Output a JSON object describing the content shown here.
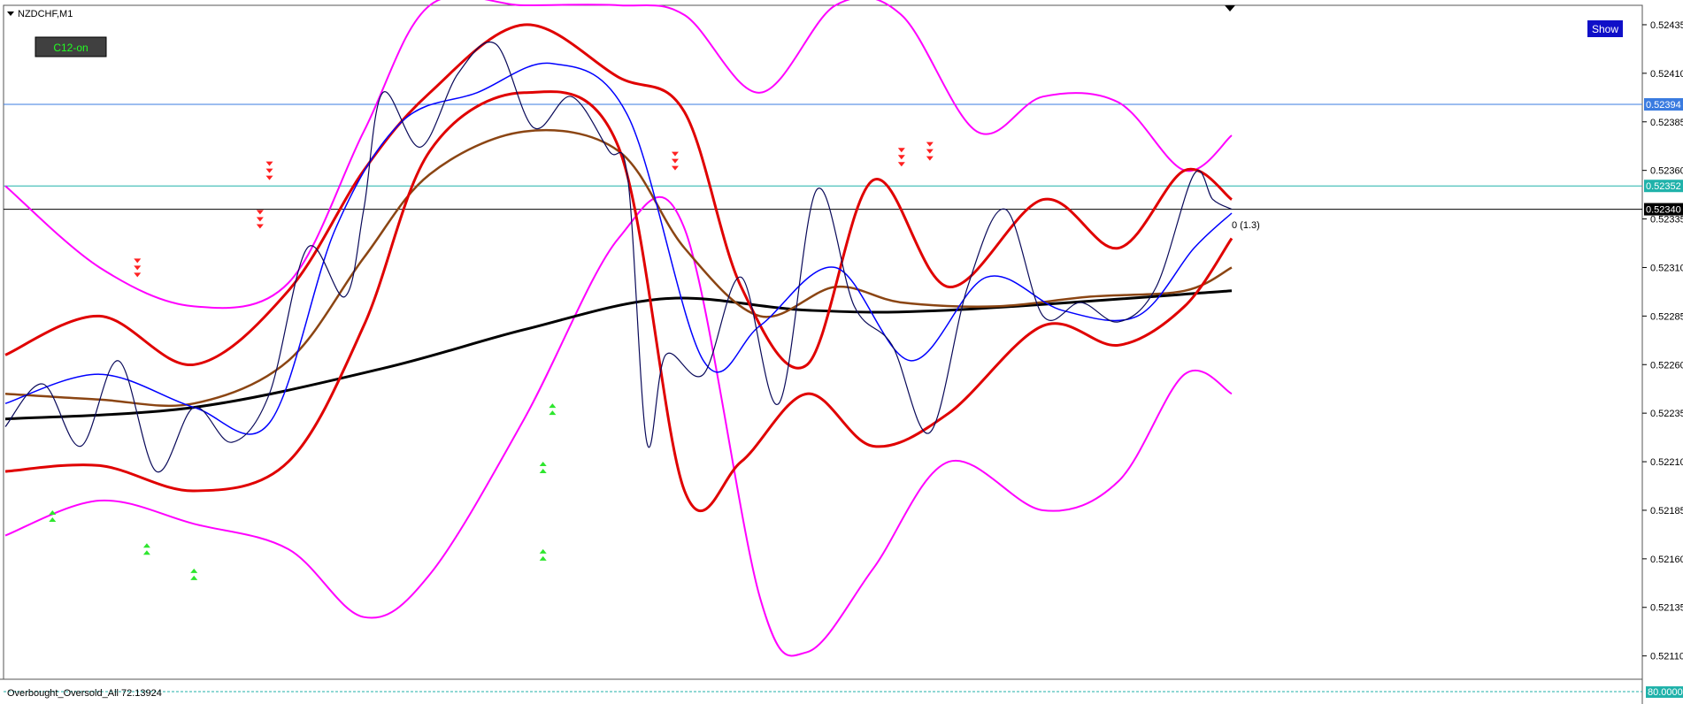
{
  "chart_data": {
    "type": "line",
    "title": "NZDCHF,M1",
    "symbol": "NZDCHF",
    "timeframe": "M1",
    "y_tick_labels": [
      "0.52435",
      "0.52410",
      "0.52385",
      "0.52360",
      "0.52335",
      "0.52310",
      "0.52285",
      "0.52260",
      "0.52235",
      "0.52210",
      "0.52185",
      "0.52160",
      "0.52135",
      "0.52110"
    ],
    "ylim": [
      0.52098,
      0.52445
    ],
    "grid": false,
    "price_level_tags": [
      {
        "value": 0.52394,
        "label": "0.52394",
        "color": "#3a7be0"
      },
      {
        "value": 0.52352,
        "label": "0.52352",
        "color": "#20b2aa"
      },
      {
        "value": 0.5234,
        "label": "0.52340",
        "color": "#000000"
      }
    ],
    "current_price_note": "0 (1.3)",
    "series": [
      {
        "role": "moving-average-long",
        "color": "#000000",
        "x": [
          0,
          20,
          40,
          55,
          70,
          85,
          100,
          130
        ],
        "values": [
          0.52232,
          0.52238,
          0.52258,
          0.52278,
          0.52294,
          0.52288,
          0.52288,
          0.52298
        ]
      },
      {
        "role": "envelope-outer-upper",
        "color": "#ff00ff",
        "x": [
          0,
          10,
          20,
          30,
          38,
          45,
          55,
          65,
          72,
          80,
          88,
          95,
          103,
          110,
          118,
          125,
          130
        ],
        "values": [
          0.52352,
          0.5231,
          0.5229,
          0.52302,
          0.5238,
          0.52445,
          0.52445,
          0.52445,
          0.5244,
          0.524,
          0.52445,
          0.5244,
          0.5238,
          0.52398,
          0.52395,
          0.5236,
          0.52378
        ]
      },
      {
        "role": "envelope-outer-lower",
        "color": "#ff00ff",
        "x": [
          0,
          10,
          20,
          30,
          38,
          45,
          55,
          65,
          72,
          80,
          85,
          92,
          100,
          110,
          118,
          125,
          130
        ],
        "values": [
          0.52172,
          0.5219,
          0.52178,
          0.52165,
          0.5213,
          0.52152,
          0.52232,
          0.52325,
          0.5233,
          0.5214,
          0.52112,
          0.52155,
          0.5221,
          0.52185,
          0.522,
          0.52255,
          0.52245
        ]
      },
      {
        "role": "band-upper",
        "color": "#e00000",
        "x": [
          0,
          10,
          20,
          30,
          38,
          45,
          55,
          65,
          72,
          78,
          85,
          92,
          100,
          110,
          118,
          125,
          130
        ],
        "values": [
          0.52265,
          0.52285,
          0.5226,
          0.52298,
          0.5236,
          0.524,
          0.52435,
          0.52408,
          0.5239,
          0.523,
          0.5226,
          0.52355,
          0.523,
          0.52345,
          0.5232,
          0.5236,
          0.52345
        ]
      },
      {
        "role": "band-lower",
        "color": "#e00000",
        "x": [
          0,
          10,
          20,
          30,
          38,
          45,
          55,
          65,
          72,
          78,
          85,
          92,
          100,
          110,
          118,
          125,
          130
        ],
        "values": [
          0.52205,
          0.52208,
          0.52195,
          0.5221,
          0.5228,
          0.5237,
          0.524,
          0.52372,
          0.52195,
          0.5221,
          0.52245,
          0.52218,
          0.52235,
          0.5228,
          0.5227,
          0.5229,
          0.52325
        ]
      },
      {
        "role": "moving-average-mid",
        "color": "#8b4513",
        "x": [
          0,
          10,
          20,
          30,
          38,
          45,
          55,
          65,
          72,
          80,
          88,
          95,
          105,
          115,
          125,
          130
        ],
        "values": [
          0.52245,
          0.52242,
          0.5224,
          0.52262,
          0.52315,
          0.52358,
          0.5238,
          0.5237,
          0.5232,
          0.52285,
          0.523,
          0.52292,
          0.5229,
          0.52295,
          0.52298,
          0.5231
        ]
      },
      {
        "role": "moving-average-fast",
        "color": "#0000ff",
        "x": [
          0,
          10,
          20,
          28,
          35,
          42,
          50,
          58,
          66,
          74,
          80,
          88,
          96,
          104,
          112,
          120,
          126,
          130
        ],
        "values": [
          0.5224,
          0.52255,
          0.52238,
          0.5223,
          0.5233,
          0.52385,
          0.524,
          0.52415,
          0.52388,
          0.52262,
          0.5228,
          0.5231,
          0.52262,
          0.52305,
          0.52288,
          0.52285,
          0.5232,
          0.52338
        ]
      },
      {
        "role": "price",
        "color": "#0a0a5a",
        "x": [
          0,
          4,
          8,
          12,
          16,
          20,
          24,
          28,
          32,
          36,
          38,
          40,
          44,
          48,
          52,
          56,
          60,
          64,
          66,
          68,
          70,
          74,
          78,
          82,
          86,
          90,
          94,
          98,
          102,
          106,
          110,
          114,
          118,
          122,
          126,
          128,
          130
        ],
        "values": [
          0.52228,
          0.5225,
          0.52218,
          0.52262,
          0.52205,
          0.52238,
          0.5222,
          0.52245,
          0.5232,
          0.52295,
          0.5234,
          0.524,
          0.52372,
          0.5241,
          0.52425,
          0.52382,
          0.52398,
          0.5237,
          0.52355,
          0.5222,
          0.52265,
          0.52255,
          0.52305,
          0.5224,
          0.5235,
          0.5229,
          0.5227,
          0.52225,
          0.523,
          0.5234,
          0.52285,
          0.52292,
          0.52282,
          0.523,
          0.52358,
          0.52345,
          0.5234
        ]
      }
    ],
    "signal_markers": [
      {
        "type": "sell",
        "x": 14,
        "value": 0.52305
      },
      {
        "type": "sell",
        "x": 27,
        "value": 0.5233
      },
      {
        "type": "sell",
        "x": 28,
        "value": 0.52355
      },
      {
        "type": "sell",
        "x": 71,
        "value": 0.5236
      },
      {
        "type": "sell",
        "x": 95,
        "value": 0.52362
      },
      {
        "type": "sell",
        "x": 98,
        "value": 0.52365
      },
      {
        "type": "buy",
        "x": 5,
        "value": 0.52185
      },
      {
        "type": "buy",
        "x": 15,
        "value": 0.52168
      },
      {
        "type": "buy",
        "x": 20,
        "value": 0.52155
      },
      {
        "type": "buy",
        "x": 57,
        "value": 0.52165
      },
      {
        "type": "buy",
        "x": 57,
        "value": 0.5221
      },
      {
        "type": "buy",
        "x": 58,
        "value": 0.5224
      }
    ],
    "subwindow": {
      "label": "Overbought_Oversold_All 72.13924",
      "level_label": "80.0000"
    }
  },
  "buttons": {
    "c12_label": "C12-on",
    "show_label": "Show"
  },
  "colors": {
    "background": "#ffffff",
    "price": "#0a0a5a",
    "band": "#e00000",
    "envelope": "#ff00ff",
    "ma_long": "#000000",
    "ma_mid": "#8b4513",
    "ma_fast": "#0000ff",
    "buy_arrow": "#2ee62e",
    "sell_arrow": "#ff2020"
  }
}
